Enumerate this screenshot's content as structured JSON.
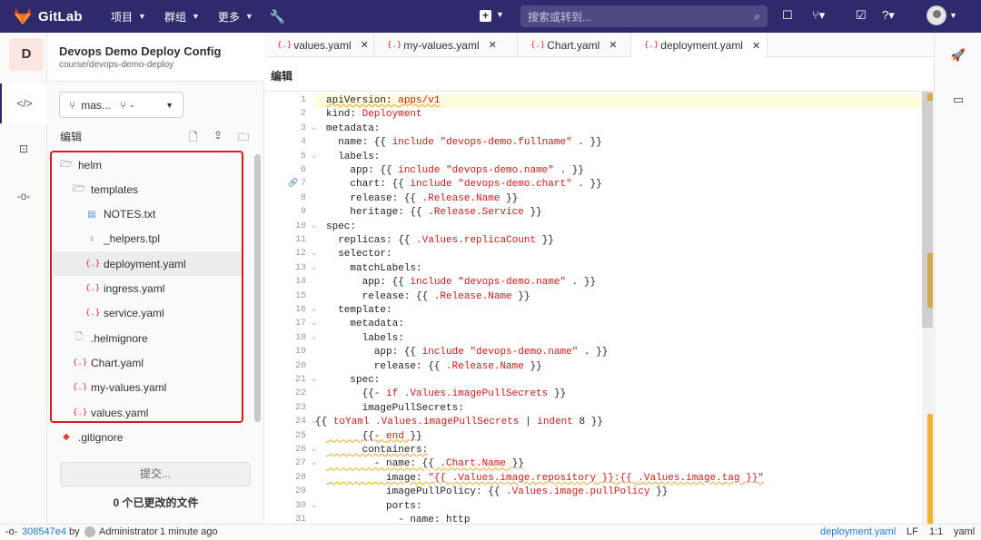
{
  "nav": {
    "brand": "GitLab",
    "items": [
      "项目",
      "群组",
      "更多"
    ],
    "search_placeholder": "搜索或转到..."
  },
  "project": {
    "avatar_letter": "D",
    "name": "Devops Demo Deploy Config",
    "path": "course/devops-demo-deploy"
  },
  "sidebar": {
    "branch": "mas...",
    "mr_label": "-",
    "edit_label": "编辑",
    "tree": [
      {
        "name": "helm",
        "icon": "folder-open-icon",
        "level": 0
      },
      {
        "name": "templates",
        "icon": "folder-open-icon",
        "level": 1
      },
      {
        "name": "NOTES.txt",
        "icon": "file-text-icon",
        "level": 2
      },
      {
        "name": "_helpers.tpl",
        "icon": "lightbulb-icon",
        "level": 2
      },
      {
        "name": "deployment.yaml",
        "icon": "yaml-icon",
        "level": 2,
        "active": true
      },
      {
        "name": "ingress.yaml",
        "icon": "yaml-icon",
        "level": 2
      },
      {
        "name": "service.yaml",
        "icon": "yaml-icon",
        "level": 2
      },
      {
        "name": ".helmignore",
        "icon": "file-icon",
        "level": 1
      },
      {
        "name": "Chart.yaml",
        "icon": "yaml-icon",
        "level": 1
      },
      {
        "name": "my-values.yaml",
        "icon": "yaml-icon",
        "level": 1
      },
      {
        "name": "values.yaml",
        "icon": "yaml-icon",
        "level": 1
      },
      {
        "name": ".gitignore",
        "icon": "git-icon",
        "level": 0
      }
    ],
    "commit_button": "提交...",
    "changed_files": "0 个已更改的文件"
  },
  "tabs": [
    {
      "label": "values.yaml"
    },
    {
      "label": "my-values.yaml"
    },
    {
      "label": "Chart.yaml"
    },
    {
      "label": "deployment.yaml",
      "active": true
    }
  ],
  "editor_tab": "编辑",
  "code": [
    "apiVersion: apps/v1",
    "kind: Deployment",
    "metadata:",
    "  name: {{ include \"devops-demo.fullname\" . }}",
    "  labels:",
    "    app: {{ include \"devops-demo.name\" . }}",
    "    chart: {{ include \"devops-demo.chart\" . }}",
    "    release: {{ .Release.Name }}",
    "    heritage: {{ .Release.Service }}",
    "spec:",
    "  replicas: {{ .Values.replicaCount }}",
    "  selector:",
    "    matchLabels:",
    "      app: {{ include \"devops-demo.name\" . }}",
    "      release: {{ .Release.Name }}",
    "  template:",
    "    metadata:",
    "      labels:",
    "        app: {{ include \"devops-demo.name\" . }}",
    "        release: {{ .Release.Name }}",
    "    spec:",
    "      {{- if .Values.imagePullSecrets }}",
    "      imagePullSecrets:",
    "{{ toYaml .Values.imagePullSecrets | indent 8 }}",
    "      {{- end }}",
    "      containers:",
    "        - name: {{ .Chart.Name }}",
    "          image: \"{{ .Values.image.repository }}:{{ .Values.image.tag }}\"",
    "          imagePullPolicy: {{ .Values.image.pullPolicy }}",
    "          ports:",
    "            - name: http"
  ],
  "status": {
    "commit": "308547e4",
    "by": "by",
    "author": "Administrator",
    "time": "1 minute ago",
    "file": "deployment.yaml",
    "eol": "LF",
    "position": "1:1",
    "lang": "yaml"
  }
}
